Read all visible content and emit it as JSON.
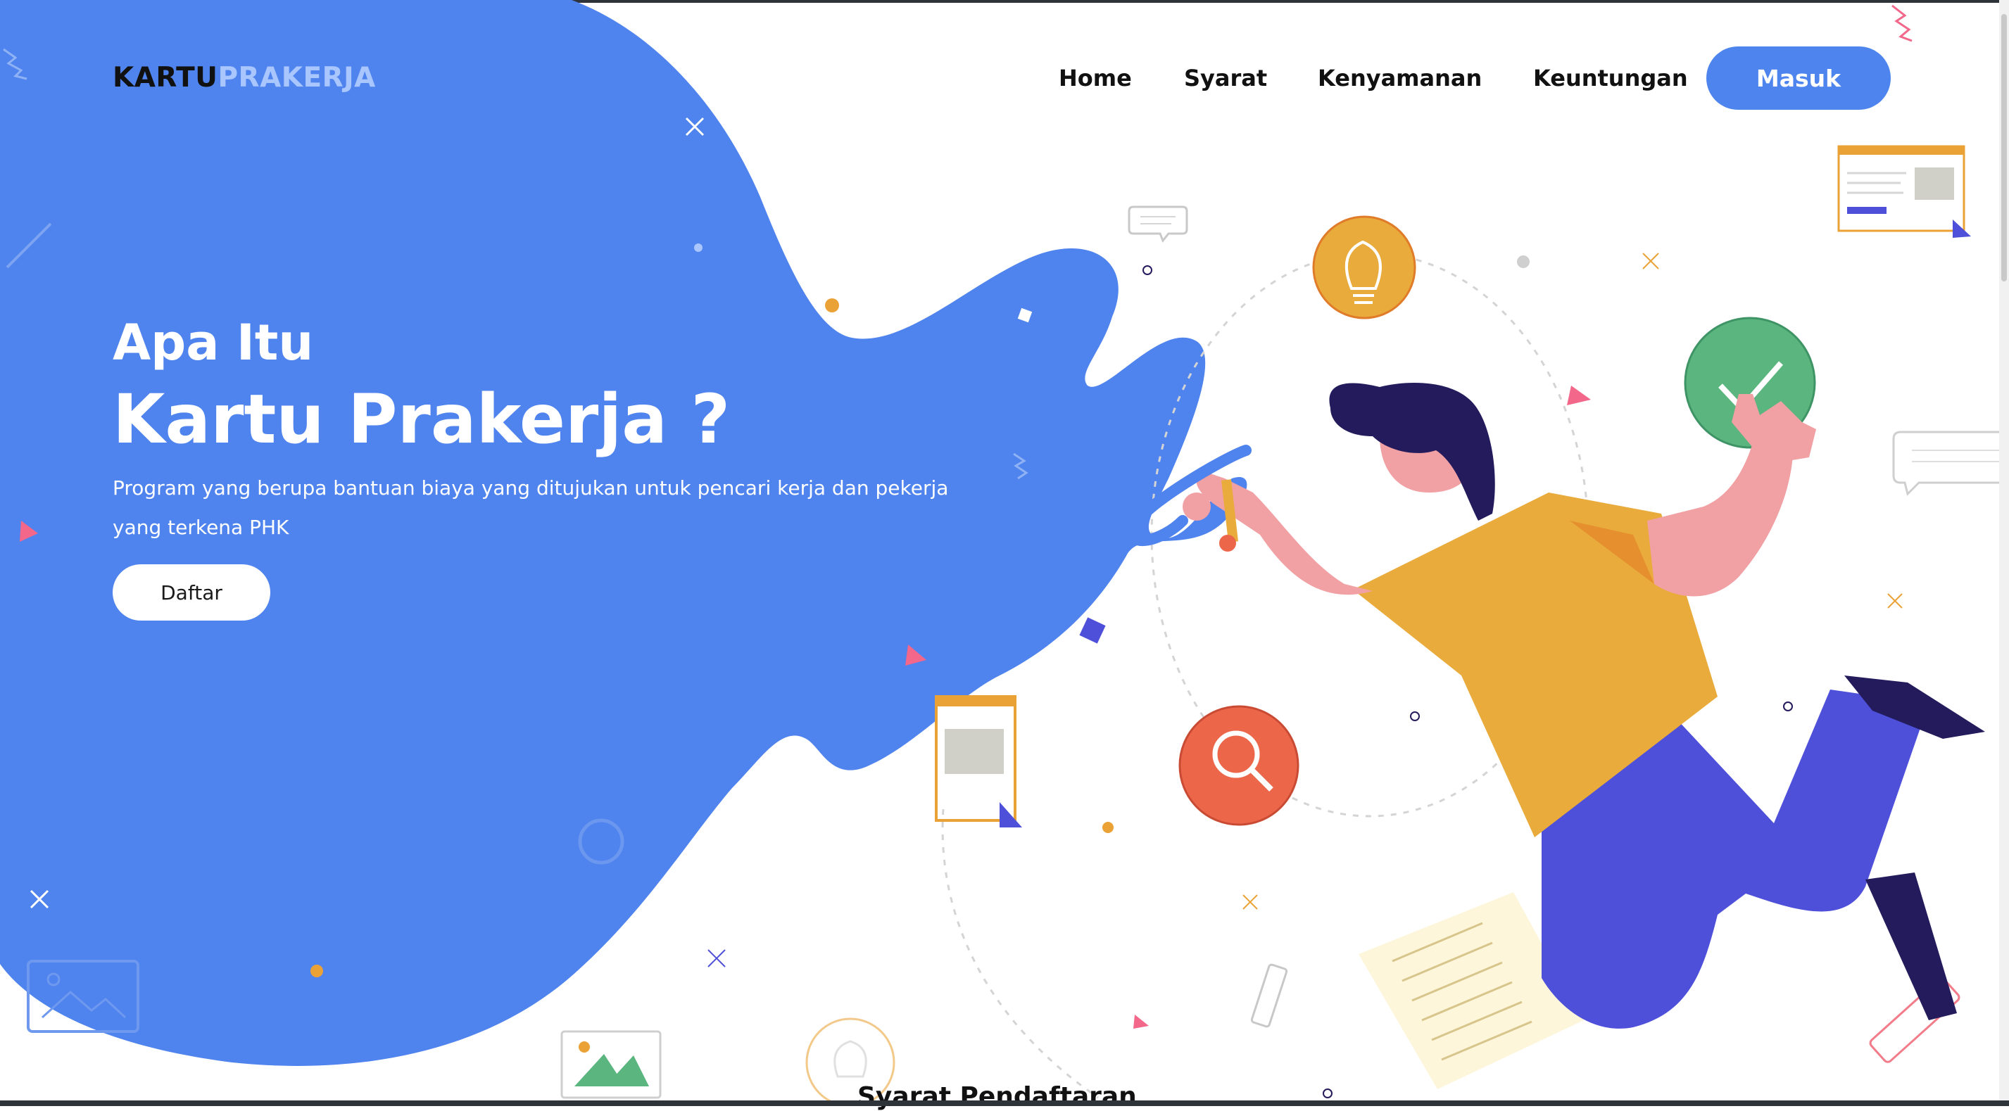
{
  "brand": {
    "part1": "KARTU",
    "part2": "PRAKERJA"
  },
  "nav": {
    "items": [
      {
        "label": "Home"
      },
      {
        "label": "Syarat"
      },
      {
        "label": "Kenyamanan"
      },
      {
        "label": "Keuntungan"
      }
    ],
    "cta_label": "Masuk"
  },
  "hero": {
    "title_small": "Apa Itu",
    "title_big": "Kartu Prakerja ?",
    "description": "Program yang berupa bantuan biaya yang ditujukan untuk pencari kerja dan pekerja yang terkena PHK",
    "button_label": "Daftar"
  },
  "next_section": {
    "title": "Syarat Pendaftaran"
  },
  "colors": {
    "primary_blue": "#4d84ee",
    "brand_light": "#a9c6ff",
    "yellow": "#e9ab3b",
    "green": "#5bb57e",
    "orange_red": "#ec664a",
    "navy": "#231b5b",
    "indigo": "#4e50da",
    "skin": "#f1a0a3"
  },
  "icons": [
    "lightbulb-icon",
    "checkmark-icon",
    "search-icon",
    "pencil-icon",
    "image-icon",
    "chat-bubble-icon"
  ]
}
